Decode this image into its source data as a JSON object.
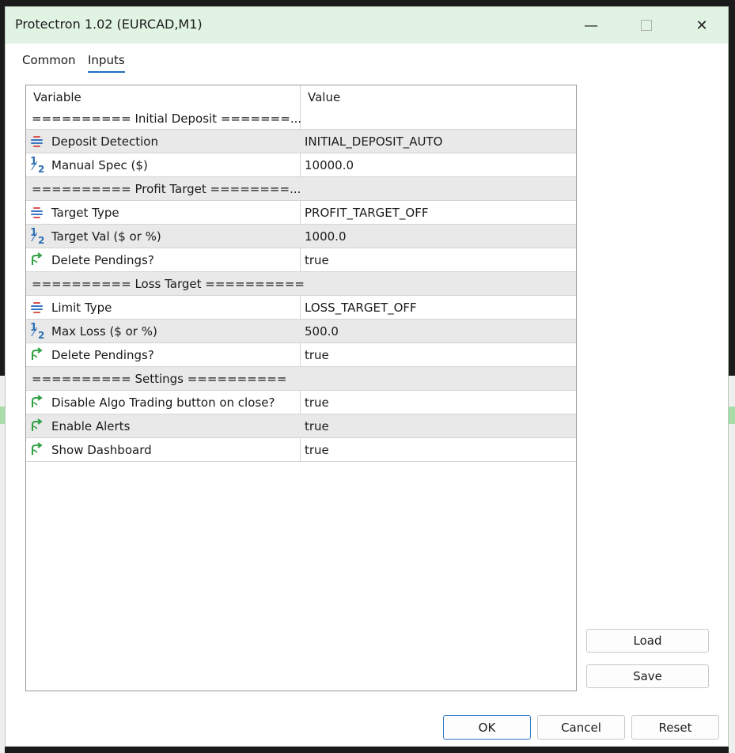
{
  "window": {
    "title": "Protectron 1.02 (EURCAD,M1)"
  },
  "tabs": [
    {
      "label": "Common",
      "active": false
    },
    {
      "label": "Inputs",
      "active": true
    }
  ],
  "grid": {
    "columns": [
      "Variable",
      "Value"
    ],
    "first_group": "========== Initial Deposit =======...",
    "rows": [
      {
        "icon": "enum-icon",
        "name": "Deposit Detection",
        "value": "INITIAL_DEPOSIT_AUTO"
      },
      {
        "icon": "double-icon",
        "name": "Manual Spec ($)",
        "value": "10000.0"
      },
      {
        "icon": "",
        "name": "========== Profit Target ========...",
        "value": ""
      },
      {
        "icon": "enum-icon",
        "name": "Target Type",
        "value": "PROFIT_TARGET_OFF"
      },
      {
        "icon": "double-icon",
        "name": "Target Val ($ or %)",
        "value": "1000.0"
      },
      {
        "icon": "bool-icon",
        "name": "Delete Pendings?",
        "value": "true"
      },
      {
        "icon": "",
        "name": "========== Loss Target ==========",
        "value": ""
      },
      {
        "icon": "enum-icon",
        "name": "Limit Type",
        "value": "LOSS_TARGET_OFF"
      },
      {
        "icon": "double-icon",
        "name": "Max Loss ($ or %)",
        "value": "500.0"
      },
      {
        "icon": "bool-icon",
        "name": "Delete Pendings?",
        "value": "true"
      },
      {
        "icon": "",
        "name": "========== Settings ==========",
        "value": ""
      },
      {
        "icon": "bool-icon",
        "name": "Disable Algo Trading button on close?",
        "value": "true"
      },
      {
        "icon": "bool-icon",
        "name": "Enable Alerts",
        "value": "true"
      },
      {
        "icon": "bool-icon",
        "name": "Show Dashboard",
        "value": "true"
      }
    ]
  },
  "side_buttons": {
    "load": "Load",
    "save": "Save"
  },
  "footer": {
    "ok": "OK",
    "cancel": "Cancel",
    "reset": "Reset"
  },
  "colors": {
    "titlebar": "#e1f4e4",
    "accent": "#1f6fbf",
    "enum_blue": "#3a78c4",
    "enum_red": "#d9534f",
    "bool_green": "#2ea043",
    "double_blue": "#2e6fb5"
  }
}
